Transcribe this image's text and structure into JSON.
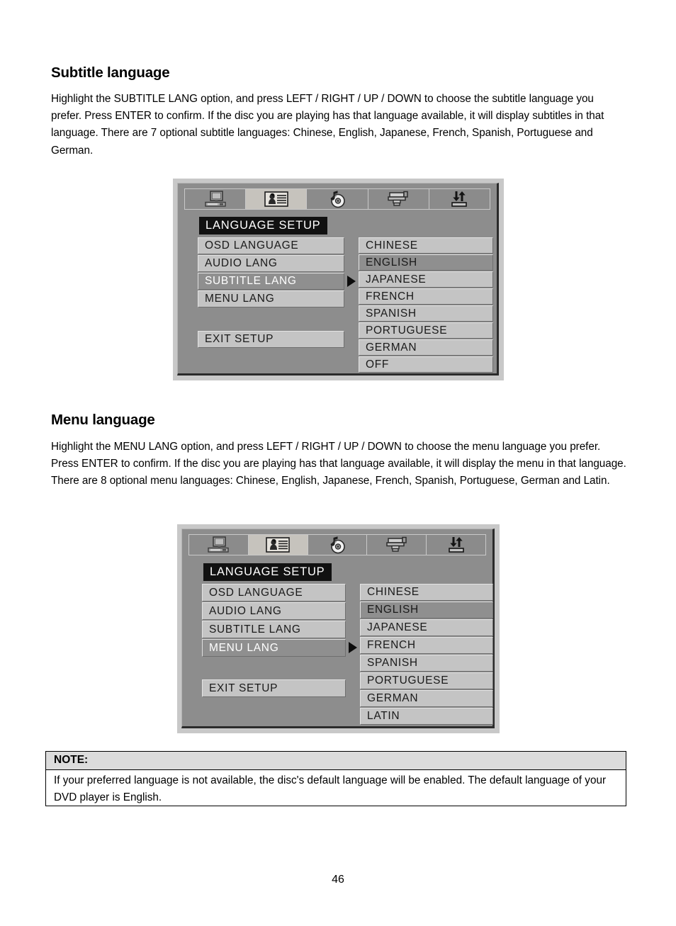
{
  "page": {
    "number": "46"
  },
  "sections": [
    {
      "heading": "Subtitle language",
      "body": "Highlight the SUBTITLE LANG option, and press LEFT / RIGHT / UP / DOWN to choose the subtitle language you prefer. Press ENTER to confirm. If the disc you are playing has that language available, it will display subtitles in that language. There are 7 optional subtitle languages: Chinese, English, Japanese, French, Spanish, Portuguese and German."
    },
    {
      "heading": "Menu language",
      "body": "Highlight the MENU LANG option, and press LEFT / RIGHT / UP / DOWN to choose the menu language you prefer. Press ENTER to confirm. If the disc you are playing has that language available, it will display the menu in that language. There are 8 optional menu languages: Chinese, English, Japanese, French, Spanish, Portuguese, German and Latin."
    }
  ],
  "osd_screens": [
    {
      "name": "subtitle-lang-osd",
      "tabs": [
        {
          "icon": "monitor-icon",
          "active": false
        },
        {
          "icon": "language-person-icon",
          "active": true
        },
        {
          "icon": "disc-music-icon",
          "active": false
        },
        {
          "icon": "camcorder-icon",
          "active": false
        },
        {
          "icon": "preferences-arrows-icon",
          "active": false
        }
      ],
      "title": "LANGUAGE SETUP",
      "menu_items": [
        {
          "label": "OSD LANGUAGE",
          "selected": false
        },
        {
          "label": "AUDIO LANG",
          "selected": false
        },
        {
          "label": "SUBTITLE LANG",
          "selected": true
        },
        {
          "label": "MENU LANG",
          "selected": false
        }
      ],
      "exit_label": "EXIT SETUP",
      "options": [
        {
          "label": "CHINESE",
          "selected": false
        },
        {
          "label": "ENGLISH",
          "selected": true
        },
        {
          "label": "JAPANESE",
          "selected": false
        },
        {
          "label": "FRENCH",
          "selected": false
        },
        {
          "label": "SPANISH",
          "selected": false
        },
        {
          "label": "PORTUGUESE",
          "selected": false
        },
        {
          "label": "GERMAN",
          "selected": false
        },
        {
          "label": "OFF",
          "selected": false
        }
      ]
    },
    {
      "name": "menu-lang-osd",
      "tabs": [
        {
          "icon": "monitor-icon",
          "active": false
        },
        {
          "icon": "language-person-icon",
          "active": true
        },
        {
          "icon": "disc-music-icon",
          "active": false
        },
        {
          "icon": "camcorder-icon",
          "active": false
        },
        {
          "icon": "preferences-arrows-icon",
          "active": false
        }
      ],
      "title": "LANGUAGE SETUP",
      "menu_items": [
        {
          "label": "OSD LANGUAGE",
          "selected": false
        },
        {
          "label": "AUDIO LANG",
          "selected": false
        },
        {
          "label": "SUBTITLE LANG",
          "selected": false
        },
        {
          "label": "MENU LANG",
          "selected": true
        }
      ],
      "exit_label": "EXIT SETUP",
      "options": [
        {
          "label": "CHINESE",
          "selected": false
        },
        {
          "label": "ENGLISH",
          "selected": true
        },
        {
          "label": "JAPANESE",
          "selected": false
        },
        {
          "label": "FRENCH",
          "selected": false
        },
        {
          "label": "SPANISH",
          "selected": false
        },
        {
          "label": "PORTUGUESE",
          "selected": false
        },
        {
          "label": "GERMAN",
          "selected": false
        },
        {
          "label": "LATIN",
          "selected": false
        }
      ]
    }
  ],
  "note": {
    "heading": "NOTE:",
    "body": "If your preferred language is not available, the disc's default language will be enabled. The default language of your DVD player is English."
  },
  "colors": {
    "osd_frame": "#c8c8c8",
    "osd_body": "#8d8d8d",
    "row_bg": "#c4c4c4",
    "row_selected_bg": "#8f8f8f",
    "title_bg": "#111111",
    "note_head_bg": "#dcdcdc"
  }
}
